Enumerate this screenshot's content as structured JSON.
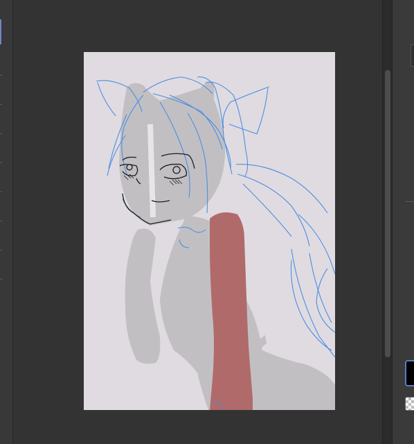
{
  "app": {
    "workspace_bg": "#333333",
    "canvas_bg": "#e0dbe1"
  },
  "left_strip": {
    "tool_count": 10,
    "active_indicator_color": "#6e86c9"
  },
  "canvas": {
    "layers": [
      {
        "name": "sketch-lines",
        "color": "#4a8fe0"
      },
      {
        "name": "gray-base-fill",
        "color": "#c2bfc3"
      },
      {
        "name": "red-strap",
        "color": "#b06a6a"
      },
      {
        "name": "line-art",
        "color": "#1c1c1c"
      }
    ]
  },
  "right_dock": {
    "main_color": "#000000",
    "sub_color_icon": "transparent-checker-icon",
    "accent": "#5b7cc6"
  }
}
